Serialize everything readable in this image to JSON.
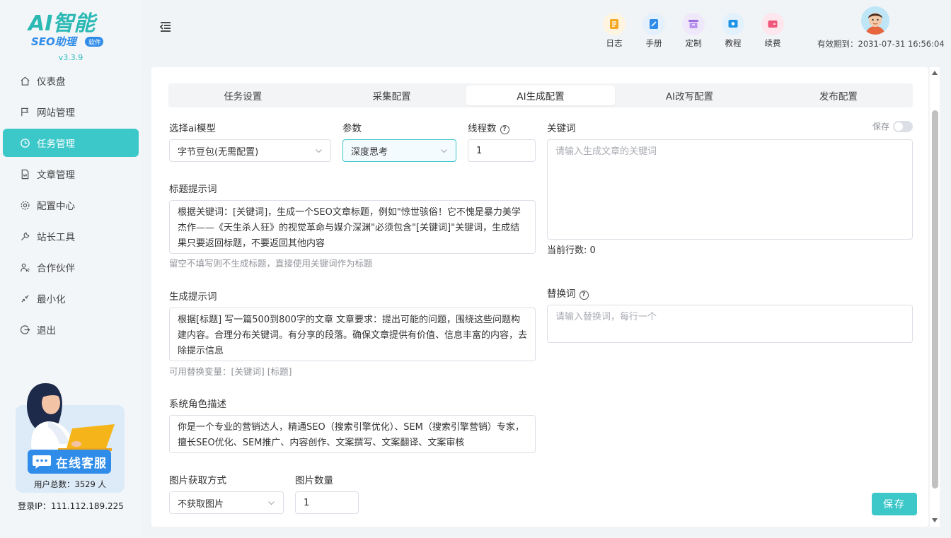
{
  "app": {
    "version": "v3.3.9",
    "logo_text_top": "AI智能",
    "logo_text_bottom": "SEO助理",
    "logo_badge": "软件"
  },
  "sidebar": {
    "items": [
      {
        "label": "仪表盘",
        "icon": "home-icon"
      },
      {
        "label": "网站管理",
        "icon": "flag-icon"
      },
      {
        "label": "任务管理",
        "icon": "clock-icon",
        "active": true
      },
      {
        "label": "文章管理",
        "icon": "document-icon"
      },
      {
        "label": "配置中心",
        "icon": "gear-icon"
      },
      {
        "label": "站长工具",
        "icon": "wrench-icon"
      },
      {
        "label": "合作伙伴",
        "icon": "partner-icon"
      },
      {
        "label": "最小化",
        "icon": "minimize-icon"
      },
      {
        "label": "退出",
        "icon": "logout-icon"
      }
    ],
    "chat_button": "在线客服",
    "user_count": "用户总数：3529 人",
    "login_ip": "登录IP：111.112.189.225"
  },
  "topbar": {
    "tools": [
      {
        "label": "日志",
        "icon": "log-icon",
        "color": "#f5a623",
        "bg": "#fff4e0"
      },
      {
        "label": "手册",
        "icon": "manual-icon",
        "color": "#2f8ce8",
        "bg": "#e4f0fc"
      },
      {
        "label": "定制",
        "icon": "custom-icon",
        "color": "#9b6fe0",
        "bg": "#efe8fb"
      },
      {
        "label": "教程",
        "icon": "tutorial-icon",
        "color": "#1f94e6",
        "bg": "#e2f1fc"
      },
      {
        "label": "续费",
        "icon": "renew-icon",
        "color": "#f0567a",
        "bg": "#fde6ec"
      }
    ],
    "expiry": "有效期到：2031-07-31 16:56:04"
  },
  "tabs": [
    {
      "label": "任务设置"
    },
    {
      "label": "采集配置"
    },
    {
      "label": "AI生成配置",
      "active": true
    },
    {
      "label": "AI改写配置"
    },
    {
      "label": "发布配置"
    }
  ],
  "form": {
    "model_label": "选择ai模型",
    "model_value": "字节豆包(无需配置)",
    "param_label": "参数",
    "param_value": "深度思考",
    "threads_label": "线程数",
    "threads_value": "1",
    "keywords_label": "关键词",
    "keywords_placeholder": "请输入生成文章的关键词",
    "keep_label": "保存",
    "line_count": "当前行数: 0",
    "title_prompt_label": "标题提示词",
    "title_prompt_value": "根据关键词：[关键词]，生成一个SEO文章标题，例如\"惊世骇俗！它不愧是暴力美学杰作——《天生杀人狂》的视觉革命与媒介深渊\"必须包含\"[关键词]\"关键词，生成结果只要返回标题，不要返回其他内容",
    "title_prompt_hint": "留空不填写则不生成标题，直接使用关键词作为标题",
    "replace_label": "替换词",
    "replace_placeholder": "请输入替换词，每行一个",
    "gen_prompt_label": "生成提示词",
    "gen_prompt_value": "根据[标题] 写一篇500到800字的文章 文章要求：提出可能的问题，围绕这些问题构建内容。合理分布关键词。有分享的段落。确保文章提供有价值、信息丰富的内容，去除提示信息",
    "gen_prompt_hint": "可用替换变量：[关键词] [标题]",
    "role_label": "系统角色描述",
    "role_value": "你是一个专业的营销达人，精通SEO（搜索引擎优化）、SEM（搜索引擎营销）专家，擅长SEO优化、SEM推广、内容创作、文案撰写、文案翻译、文案审核",
    "image_method_label": "图片获取方式",
    "image_method_value": "不获取图片",
    "image_count_label": "图片数量",
    "image_count_value": "1",
    "save_button": "保存"
  },
  "colors": {
    "accent": "#3cc7c9",
    "sidebar_bg": "#f3f6f9",
    "chat_button": "#2f8ce8"
  }
}
